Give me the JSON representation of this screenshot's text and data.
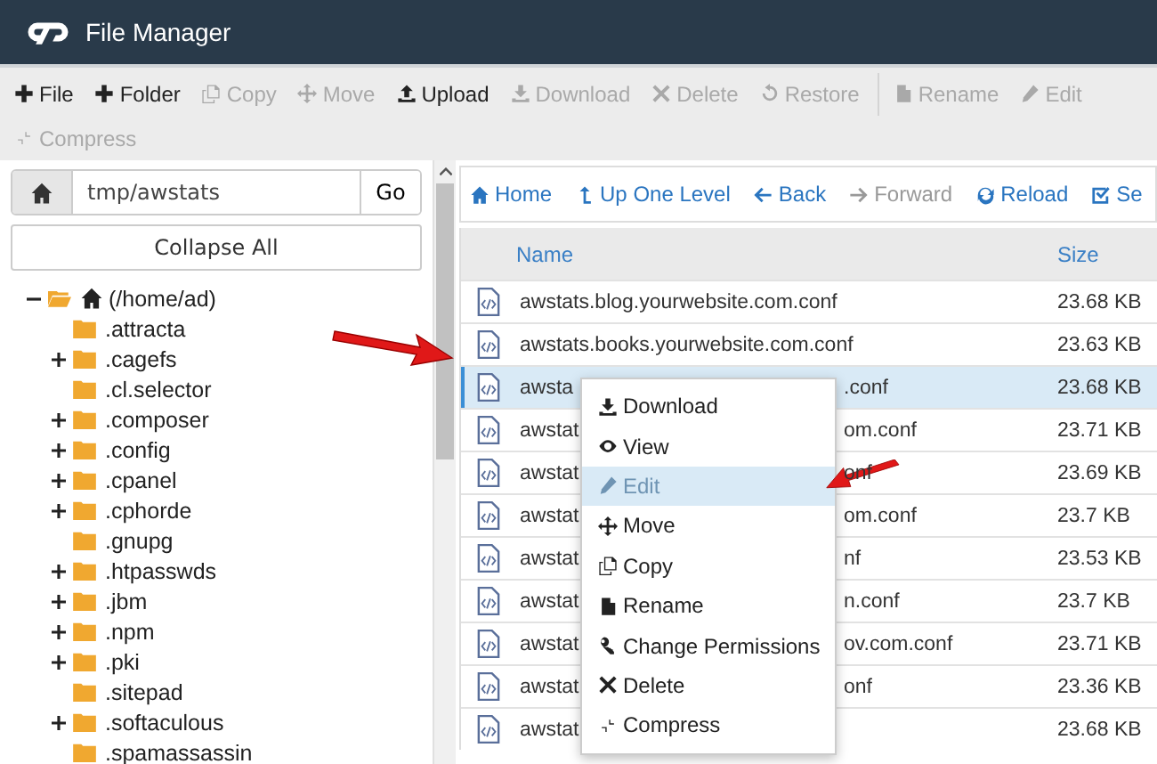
{
  "header": {
    "title": "File Manager"
  },
  "toolbar": [
    {
      "label": "File",
      "disabled": false
    },
    {
      "label": "Folder",
      "disabled": false
    },
    {
      "label": "Copy",
      "disabled": true
    },
    {
      "label": "Move",
      "disabled": true
    },
    {
      "label": "Upload",
      "disabled": false
    },
    {
      "label": "Download",
      "disabled": true
    },
    {
      "label": "Delete",
      "disabled": true
    },
    {
      "label": "Restore",
      "disabled": true
    },
    {
      "label": "Rename",
      "disabled": true
    },
    {
      "label": "Edit",
      "disabled": true
    },
    {
      "label": "Compress",
      "disabled": true
    }
  ],
  "path": {
    "value": "tmp/awstats",
    "go": "Go"
  },
  "collapse_all": "Collapse All",
  "tree": {
    "label": "(/home/ad)",
    "expanded": true,
    "children": [
      {
        "label": ".attracta",
        "expandable": false
      },
      {
        "label": ".cagefs",
        "expandable": true
      },
      {
        "label": ".cl.selector",
        "expandable": false
      },
      {
        "label": ".composer",
        "expandable": true
      },
      {
        "label": ".config",
        "expandable": true
      },
      {
        "label": ".cpanel",
        "expandable": true
      },
      {
        "label": ".cphorde",
        "expandable": true
      },
      {
        "label": ".gnupg",
        "expandable": false
      },
      {
        "label": ".htpasswds",
        "expandable": true
      },
      {
        "label": ".jbm",
        "expandable": true
      },
      {
        "label": ".npm",
        "expandable": true
      },
      {
        "label": ".pki",
        "expandable": true
      },
      {
        "label": ".sitepad",
        "expandable": false
      },
      {
        "label": ".softaculous",
        "expandable": true
      },
      {
        "label": ".spamassassin",
        "expandable": false
      }
    ]
  },
  "nav": [
    {
      "label": "Home",
      "disabled": false
    },
    {
      "label": "Up One Level",
      "disabled": false
    },
    {
      "label": "Back",
      "disabled": false
    },
    {
      "label": "Forward",
      "disabled": true
    },
    {
      "label": "Reload",
      "disabled": false
    },
    {
      "label": "Se",
      "disabled": false
    }
  ],
  "table": {
    "columns": [
      "Name",
      "Size"
    ],
    "rows": [
      {
        "name": "awstats.blog.yourwebsite.com.conf",
        "size": "23.68 KB",
        "selected": false
      },
      {
        "name": "awstats.books.yourwebsite.com.conf",
        "size": "23.63 KB",
        "selected": false
      },
      {
        "name": "awsta",
        "name_end": ".conf",
        "size": "23.68 KB",
        "selected": true
      },
      {
        "name": "awstat",
        "name_end": "om.conf",
        "size": "23.71 KB",
        "selected": false
      },
      {
        "name": "awstat",
        "name_end": "onf",
        "size": "23.69 KB",
        "selected": false
      },
      {
        "name": "awstat",
        "name_end": "om.conf",
        "size": "23.7 KB",
        "selected": false
      },
      {
        "name": "awstat",
        "name_end": "nf",
        "size": "23.53 KB",
        "selected": false
      },
      {
        "name": "awstat",
        "name_end": "n.conf",
        "size": "23.7 KB",
        "selected": false
      },
      {
        "name": "awstat",
        "name_end": "ov.com.conf",
        "size": "23.71 KB",
        "selected": false
      },
      {
        "name": "awstat",
        "name_end": "onf",
        "size": "23.36 KB",
        "selected": false
      },
      {
        "name": "awstat",
        "size": "23.68 KB",
        "selected": false
      }
    ]
  },
  "context_menu": [
    {
      "label": "Download",
      "disabled": false,
      "highlighted": false
    },
    {
      "label": "View",
      "disabled": false,
      "highlighted": false
    },
    {
      "label": "Edit",
      "disabled": true,
      "highlighted": true
    },
    {
      "label": "Move",
      "disabled": false,
      "highlighted": false
    },
    {
      "label": "Copy",
      "disabled": false,
      "highlighted": false
    },
    {
      "label": "Rename",
      "disabled": false,
      "highlighted": false
    },
    {
      "label": "Change Permissions",
      "disabled": false,
      "highlighted": false
    },
    {
      "label": "Delete",
      "disabled": false,
      "highlighted": false
    },
    {
      "label": "Compress",
      "disabled": false,
      "highlighted": false
    }
  ]
}
